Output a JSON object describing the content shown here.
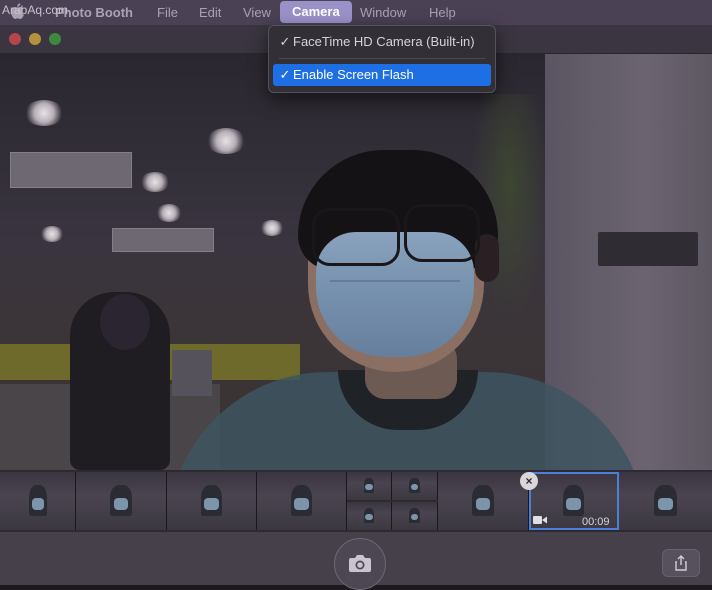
{
  "watermark": "ArabAq.com",
  "menubar": {
    "app_name": "Photo Booth",
    "menus": [
      "File",
      "Edit",
      "View",
      "Camera",
      "Window",
      "Help"
    ],
    "active_menu": "Camera"
  },
  "camera_menu": {
    "items": [
      {
        "label": "FaceTime HD Camera (Built-in)",
        "checked": true,
        "highlighted": false
      },
      {
        "label": "Enable Screen Flash",
        "checked": true,
        "highlighted": true
      }
    ],
    "checkmark": "✓"
  },
  "window": {
    "traffic_lights": [
      "close",
      "minimize",
      "zoom"
    ]
  },
  "filmstrip": {
    "selected_thumb_duration": "00:09",
    "selected_thumb_close": "×",
    "thumb_count": 10
  },
  "toolbar": {
    "shutter_icon": "camera-icon",
    "share_icon": "share-icon"
  },
  "colors": {
    "menu_highlight": "#1f6fe4",
    "active_menu_bg": "#9a91c9",
    "close": "#b2474b",
    "minimize": "#b4913d",
    "zoom": "#3d8a3f"
  }
}
